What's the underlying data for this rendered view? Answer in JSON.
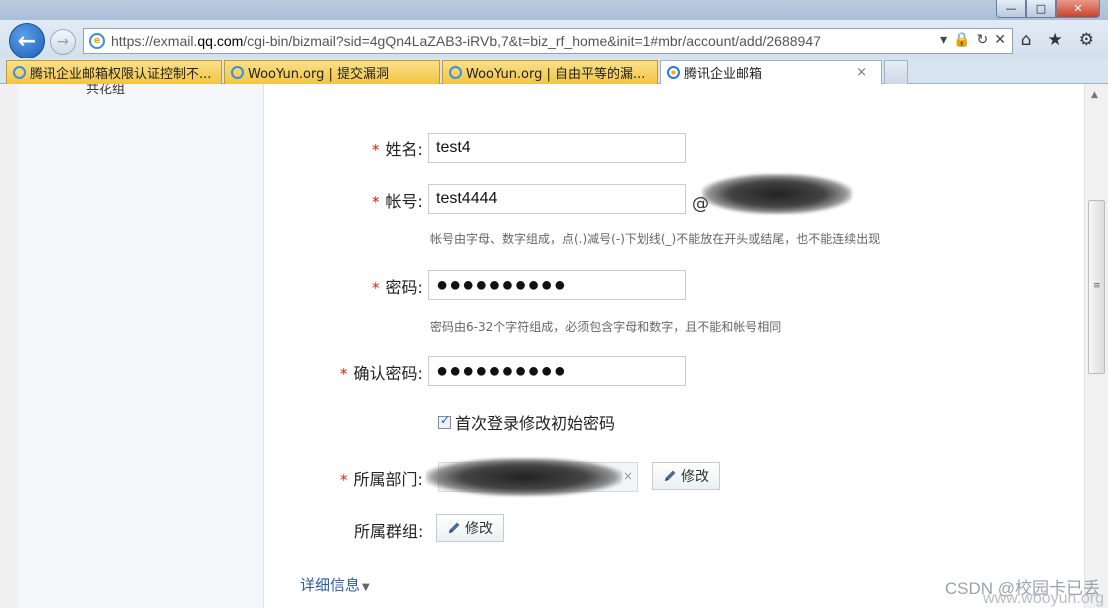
{
  "browser": {
    "url": "https://exmail.qq.com/cgi-bin/bizmail?sid=4gQn4LaZAB3-iRVb,7&t=biz_rf_home&init=1#mbr/account/add/2688947",
    "url_prefix": "https://exmail.",
    "url_host": "qq.com",
    "url_rest": "/cgi-bin/bizmail?sid=4gQn4LaZAB3-iRVb,7&t=biz_rf_home&init=1#mbr/account/add/2688947",
    "tabs": [
      {
        "label": "腾讯企业邮箱权限认证控制不...",
        "active": false
      },
      {
        "label": "WooYun.org | 提交漏洞",
        "active": false
      },
      {
        "label": "WooYun.org | 自由平等的漏...",
        "active": false
      },
      {
        "label": "腾讯企业邮箱",
        "active": true
      }
    ],
    "tab_close": "×",
    "win_min": "—",
    "win_max": "□",
    "win_close": "✕"
  },
  "sidebar": {
    "fragment": "共花组"
  },
  "form": {
    "required_mark": "*",
    "name_label": "姓名:",
    "name_value": "test4",
    "account_label": "帐号:",
    "account_value": "test4444",
    "at_sign": "@",
    "account_hint": "帐号由字母、数字组成，点(.)减号(-)下划线(_)不能放在开头或结尾，也不能连续出现",
    "password_label": "密码:",
    "password_value": "●●●●●●●●●●",
    "password_hint": "密码由6-32个字符组成，必须包含字母和数字，且不能和帐号相同",
    "confirm_label": "确认密码:",
    "confirm_value": "●●●●●●●●●●",
    "first_login_label": "首次登录修改初始密码",
    "first_login_checked": true,
    "department_label": "所属部门:",
    "modify_label": "修改",
    "group_label": "所属群组:",
    "details_label": "详细信息"
  },
  "watermark": {
    "csdn": "CSDN @校园卡已丢",
    "wooyun": "www.wooyun.org"
  },
  "colors": {
    "required": "#d0241b",
    "link": "#2b5da8"
  }
}
